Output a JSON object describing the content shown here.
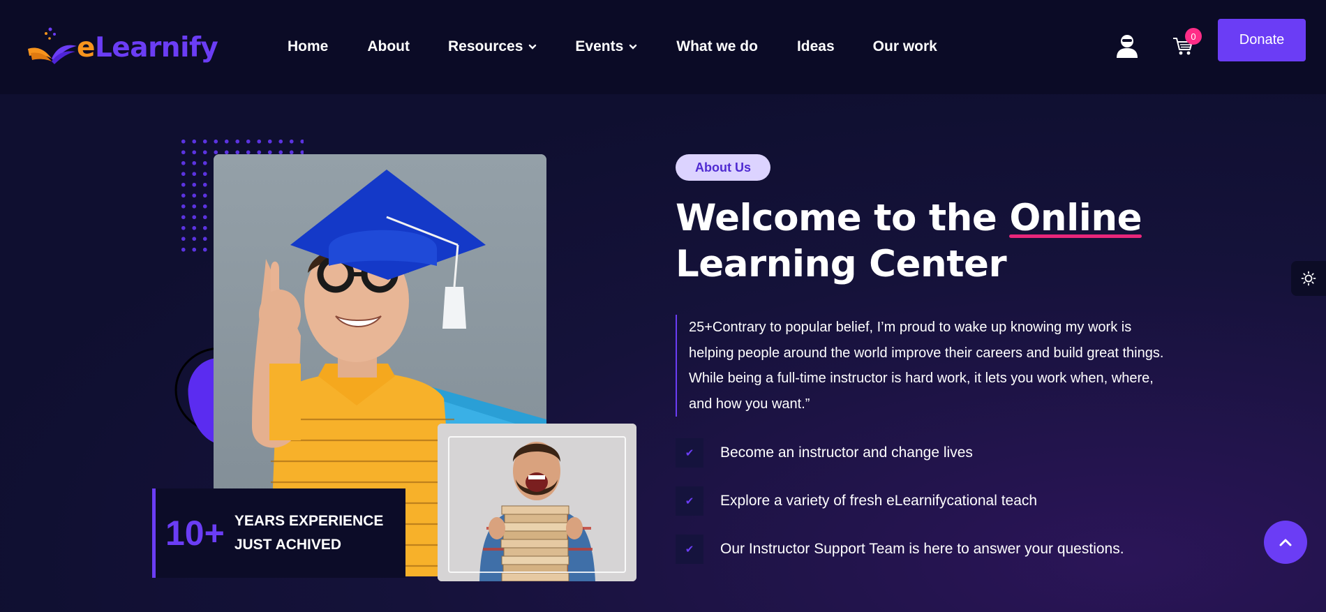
{
  "header": {
    "logo": {
      "e": "e",
      "rest": "Learnify"
    },
    "nav": [
      {
        "label": "Home",
        "has_dropdown": false
      },
      {
        "label": "About",
        "has_dropdown": false
      },
      {
        "label": "Resources",
        "has_dropdown": true
      },
      {
        "label": "Events",
        "has_dropdown": true
      },
      {
        "label": "What we do",
        "has_dropdown": false
      },
      {
        "label": "Ideas",
        "has_dropdown": false
      },
      {
        "label": "Our work",
        "has_dropdown": false
      }
    ],
    "user_icon": "user-icon",
    "cart_icon": "cart-icon",
    "cart_count": "0",
    "donate_label": "Donate"
  },
  "about": {
    "experience_number": "10+",
    "experience_text": "YEARS EXPERIENCE JUST ACHIVED",
    "pill": "About Us",
    "title_prefix": "Welcome to the ",
    "title_highlight": "Online",
    "title_suffix": "Learning Center",
    "quote": "25+Contrary to popular belief, I’m proud to wake up knowing my work is helping people around the world improve their careers and build great things. While being a full-time instructor is hard work, it lets you work when, where, and how you want.”",
    "checklist": [
      "Become an instructor and change lives",
      "Explore a variety of fresh eLearnifycational teach",
      "Our Instructor Support Team is here to answer your questions."
    ]
  },
  "widgets": {
    "theme_icon": "sun-icon",
    "scroll_top_icon": "chevron-up-icon"
  },
  "colors": {
    "accent": "#6b3df5",
    "logo_orange": "#f7941d",
    "highlight_underline": "#e8267a",
    "badge": "#ff2d87",
    "background": "#0d0d2b"
  }
}
